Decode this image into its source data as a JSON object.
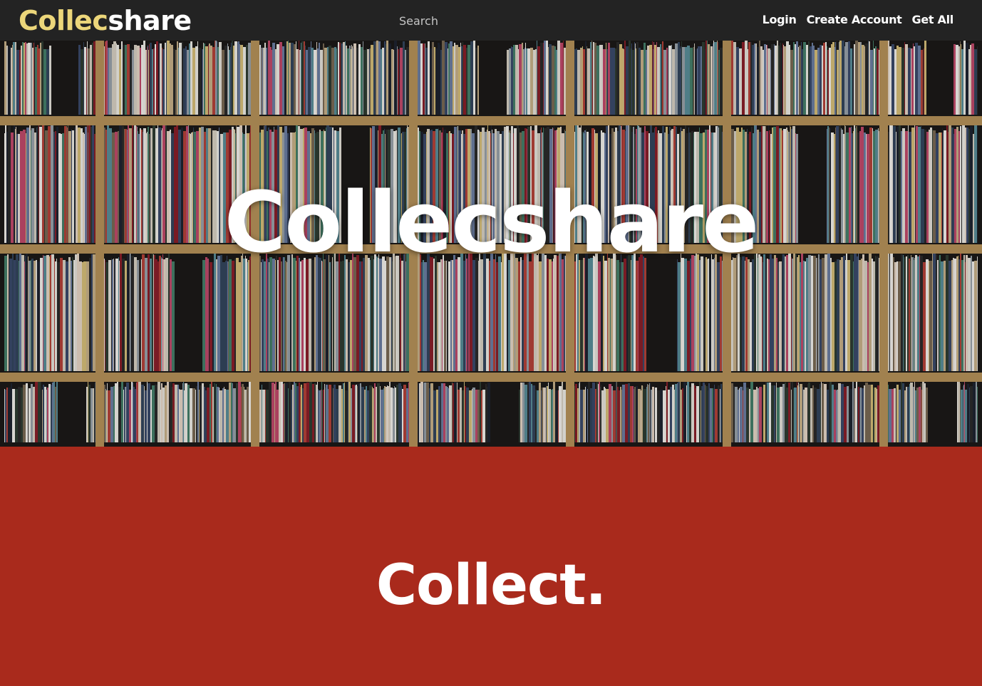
{
  "navbar": {
    "brand_part1": "Collec",
    "brand_part2": "share",
    "search_placeholder": "Search",
    "links": [
      "Login",
      "Create Account",
      "Get All"
    ]
  },
  "hero": {
    "title": "Collecshare",
    "background_image": "record-shelves-photo"
  },
  "collect_section": {
    "heading": "Collect."
  },
  "colors": {
    "navbar_bg": "#232323",
    "brand_accent": "#ecd67a",
    "section_red": "#a92a1c",
    "shelf_wood": "#b8935a"
  }
}
